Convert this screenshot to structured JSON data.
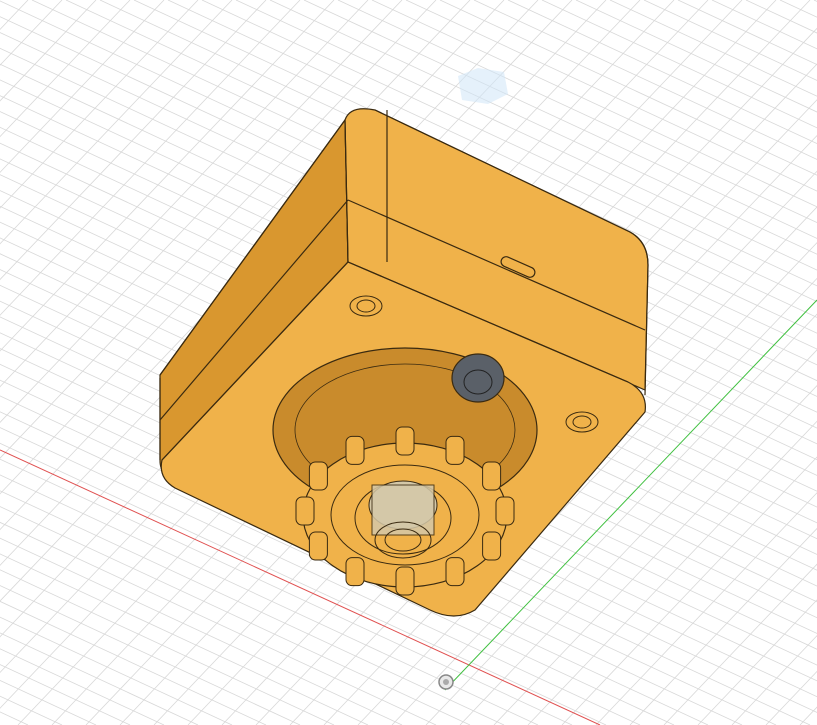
{
  "app": {
    "view": "3d-viewport",
    "background_color": "#ffffff",
    "grid_color": "#d8d8d8",
    "x_axis_color": "#e05050",
    "y_axis_color": "#40c040"
  },
  "model": {
    "body_color": "#f0b24a",
    "body_dark_color": "#d9972f",
    "body_shadow_color": "#c98b2c",
    "edge_color": "#3a2a10",
    "lens_color": "#5a6068",
    "nozzle_color": "#d4c8a8"
  },
  "view_cube": {
    "color": "#cfe6f7"
  },
  "icons": {
    "origin": "origin-marker-icon",
    "view_cube": "view-cube-icon"
  }
}
